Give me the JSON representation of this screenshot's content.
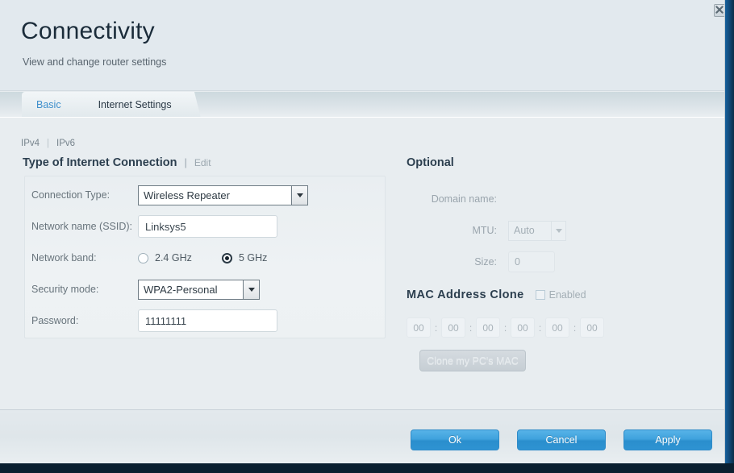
{
  "window": {
    "title": "Connectivity",
    "subtitle": "View and change router settings",
    "close_icon": "close-icon"
  },
  "tabs": [
    {
      "label": "Basic",
      "active": false
    },
    {
      "label": "Internet Settings",
      "active": true
    }
  ],
  "ip_stack": {
    "ipv4": "IPv4",
    "separator": "|",
    "ipv6": "IPv6"
  },
  "left": {
    "section_title": "Type of Internet Connection",
    "separator": "|",
    "edit_label": "Edit",
    "fields": {
      "connection_type_label": "Connection Type:",
      "connection_type_value": "Wireless Repeater",
      "ssid_label": "Network name (SSID):",
      "ssid_value": "Linksys5",
      "band_label": "Network band:",
      "band_option_1": "2.4 GHz",
      "band_option_2": "5 GHz",
      "band_selected": "5 GHz",
      "security_label": "Security mode:",
      "security_value": "WPA2-Personal",
      "password_label": "Password:",
      "password_value": "11111111"
    }
  },
  "right": {
    "optional_title": "Optional",
    "domain_label": "Domain name:",
    "mtu_label": "MTU:",
    "mtu_value": "Auto",
    "size_label": "Size:",
    "size_value": "0",
    "mac_title": "MAC Address Clone",
    "mac_enabled_label": "Enabled",
    "mac_enabled": false,
    "mac_octets": [
      "00",
      "00",
      "00",
      "00",
      "00",
      "00"
    ],
    "mac_colon": ":",
    "clone_button_label": "Clone my PC's MAC"
  },
  "footer": {
    "ok_label": "Ok",
    "cancel_label": "Cancel",
    "apply_label": "Apply"
  },
  "colors": {
    "accent_blue": "#3fa2dd",
    "link_blue": "#3e8fcc",
    "heading": "#2c3f4f",
    "window_bg": "#e8edf0",
    "border_right": "#15619e"
  }
}
